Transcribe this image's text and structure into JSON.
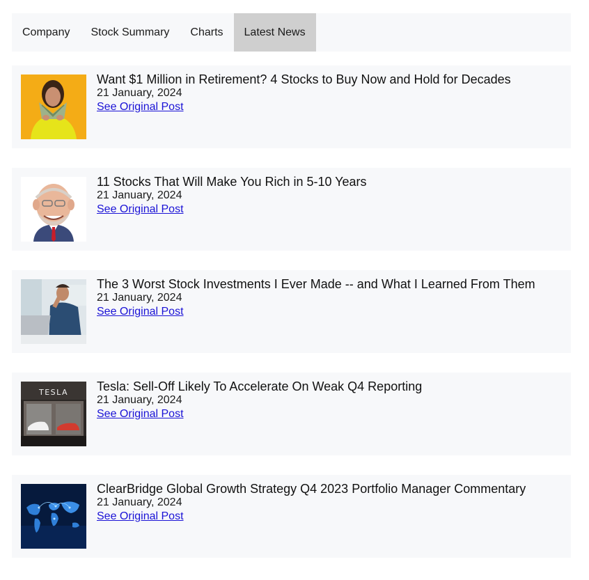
{
  "tabs": [
    {
      "label": "Company"
    },
    {
      "label": "Stock Summary"
    },
    {
      "label": "Charts"
    },
    {
      "label": "Latest News",
      "active": true
    }
  ],
  "news": [
    {
      "title": "Want $1 Million in Retirement? 4 Stocks to Buy Now and Hold for Decades",
      "date": "21 January, 2024",
      "link_label": "See Original Post",
      "thumb": "woman-holding-cash-image"
    },
    {
      "title": "11 Stocks That Will Make You Rich in 5-10 Years",
      "date": "21 January, 2024",
      "link_label": "See Original Post",
      "thumb": "caricature-man-image"
    },
    {
      "title": "The 3 Worst Stock Investments I Ever Made -- and What I Learned From Them",
      "date": "21 January, 2024",
      "link_label": "See Original Post",
      "thumb": "stressed-man-laptop-image"
    },
    {
      "title": "Tesla: Sell-Off Likely To Accelerate On Weak Q4 Reporting",
      "date": "21 January, 2024",
      "link_label": "See Original Post",
      "thumb": "tesla-showroom-image"
    },
    {
      "title": "ClearBridge Global Growth Strategy Q4 2023 Portfolio Manager Commentary",
      "date": "21 January, 2024",
      "link_label": "See Original Post",
      "thumb": "digital-world-map-image"
    }
  ],
  "thumb_logo_text": "TESLA",
  "colors": {
    "tab_bg": "#f7f8fa",
    "tab_active_bg": "#cfcfcf",
    "card_bg": "#f7f8fa",
    "link": "#1a12d6"
  }
}
